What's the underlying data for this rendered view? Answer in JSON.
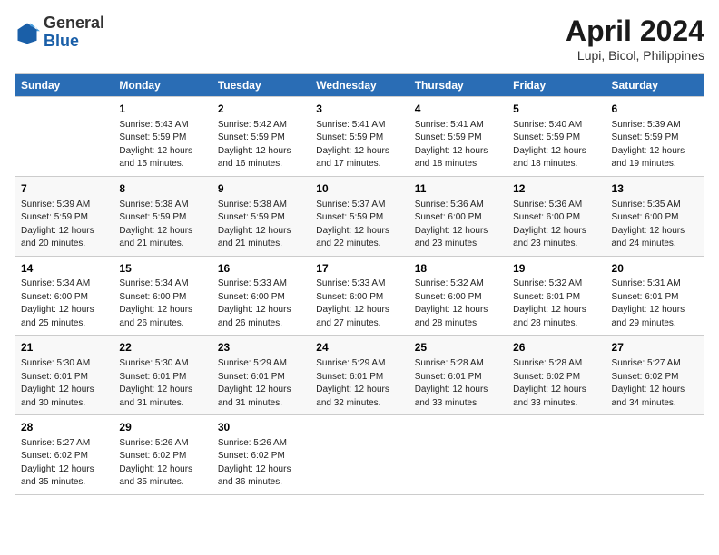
{
  "header": {
    "logo": {
      "line1": "General",
      "line2": "Blue"
    },
    "title": "April 2024",
    "location": "Lupi, Bicol, Philippines"
  },
  "days_of_week": [
    "Sunday",
    "Monday",
    "Tuesday",
    "Wednesday",
    "Thursday",
    "Friday",
    "Saturday"
  ],
  "weeks": [
    [
      {
        "day": "",
        "info": ""
      },
      {
        "day": "1",
        "info": "Sunrise: 5:43 AM\nSunset: 5:59 PM\nDaylight: 12 hours\nand 15 minutes."
      },
      {
        "day": "2",
        "info": "Sunrise: 5:42 AM\nSunset: 5:59 PM\nDaylight: 12 hours\nand 16 minutes."
      },
      {
        "day": "3",
        "info": "Sunrise: 5:41 AM\nSunset: 5:59 PM\nDaylight: 12 hours\nand 17 minutes."
      },
      {
        "day": "4",
        "info": "Sunrise: 5:41 AM\nSunset: 5:59 PM\nDaylight: 12 hours\nand 18 minutes."
      },
      {
        "day": "5",
        "info": "Sunrise: 5:40 AM\nSunset: 5:59 PM\nDaylight: 12 hours\nand 18 minutes."
      },
      {
        "day": "6",
        "info": "Sunrise: 5:39 AM\nSunset: 5:59 PM\nDaylight: 12 hours\nand 19 minutes."
      }
    ],
    [
      {
        "day": "7",
        "info": "Sunrise: 5:39 AM\nSunset: 5:59 PM\nDaylight: 12 hours\nand 20 minutes."
      },
      {
        "day": "8",
        "info": "Sunrise: 5:38 AM\nSunset: 5:59 PM\nDaylight: 12 hours\nand 21 minutes."
      },
      {
        "day": "9",
        "info": "Sunrise: 5:38 AM\nSunset: 5:59 PM\nDaylight: 12 hours\nand 21 minutes."
      },
      {
        "day": "10",
        "info": "Sunrise: 5:37 AM\nSunset: 5:59 PM\nDaylight: 12 hours\nand 22 minutes."
      },
      {
        "day": "11",
        "info": "Sunrise: 5:36 AM\nSunset: 6:00 PM\nDaylight: 12 hours\nand 23 minutes."
      },
      {
        "day": "12",
        "info": "Sunrise: 5:36 AM\nSunset: 6:00 PM\nDaylight: 12 hours\nand 23 minutes."
      },
      {
        "day": "13",
        "info": "Sunrise: 5:35 AM\nSunset: 6:00 PM\nDaylight: 12 hours\nand 24 minutes."
      }
    ],
    [
      {
        "day": "14",
        "info": "Sunrise: 5:34 AM\nSunset: 6:00 PM\nDaylight: 12 hours\nand 25 minutes."
      },
      {
        "day": "15",
        "info": "Sunrise: 5:34 AM\nSunset: 6:00 PM\nDaylight: 12 hours\nand 26 minutes."
      },
      {
        "day": "16",
        "info": "Sunrise: 5:33 AM\nSunset: 6:00 PM\nDaylight: 12 hours\nand 26 minutes."
      },
      {
        "day": "17",
        "info": "Sunrise: 5:33 AM\nSunset: 6:00 PM\nDaylight: 12 hours\nand 27 minutes."
      },
      {
        "day": "18",
        "info": "Sunrise: 5:32 AM\nSunset: 6:00 PM\nDaylight: 12 hours\nand 28 minutes."
      },
      {
        "day": "19",
        "info": "Sunrise: 5:32 AM\nSunset: 6:01 PM\nDaylight: 12 hours\nand 28 minutes."
      },
      {
        "day": "20",
        "info": "Sunrise: 5:31 AM\nSunset: 6:01 PM\nDaylight: 12 hours\nand 29 minutes."
      }
    ],
    [
      {
        "day": "21",
        "info": "Sunrise: 5:30 AM\nSunset: 6:01 PM\nDaylight: 12 hours\nand 30 minutes."
      },
      {
        "day": "22",
        "info": "Sunrise: 5:30 AM\nSunset: 6:01 PM\nDaylight: 12 hours\nand 31 minutes."
      },
      {
        "day": "23",
        "info": "Sunrise: 5:29 AM\nSunset: 6:01 PM\nDaylight: 12 hours\nand 31 minutes."
      },
      {
        "day": "24",
        "info": "Sunrise: 5:29 AM\nSunset: 6:01 PM\nDaylight: 12 hours\nand 32 minutes."
      },
      {
        "day": "25",
        "info": "Sunrise: 5:28 AM\nSunset: 6:01 PM\nDaylight: 12 hours\nand 33 minutes."
      },
      {
        "day": "26",
        "info": "Sunrise: 5:28 AM\nSunset: 6:02 PM\nDaylight: 12 hours\nand 33 minutes."
      },
      {
        "day": "27",
        "info": "Sunrise: 5:27 AM\nSunset: 6:02 PM\nDaylight: 12 hours\nand 34 minutes."
      }
    ],
    [
      {
        "day": "28",
        "info": "Sunrise: 5:27 AM\nSunset: 6:02 PM\nDaylight: 12 hours\nand 35 minutes."
      },
      {
        "day": "29",
        "info": "Sunrise: 5:26 AM\nSunset: 6:02 PM\nDaylight: 12 hours\nand 35 minutes."
      },
      {
        "day": "30",
        "info": "Sunrise: 5:26 AM\nSunset: 6:02 PM\nDaylight: 12 hours\nand 36 minutes."
      },
      {
        "day": "",
        "info": ""
      },
      {
        "day": "",
        "info": ""
      },
      {
        "day": "",
        "info": ""
      },
      {
        "day": "",
        "info": ""
      }
    ]
  ]
}
